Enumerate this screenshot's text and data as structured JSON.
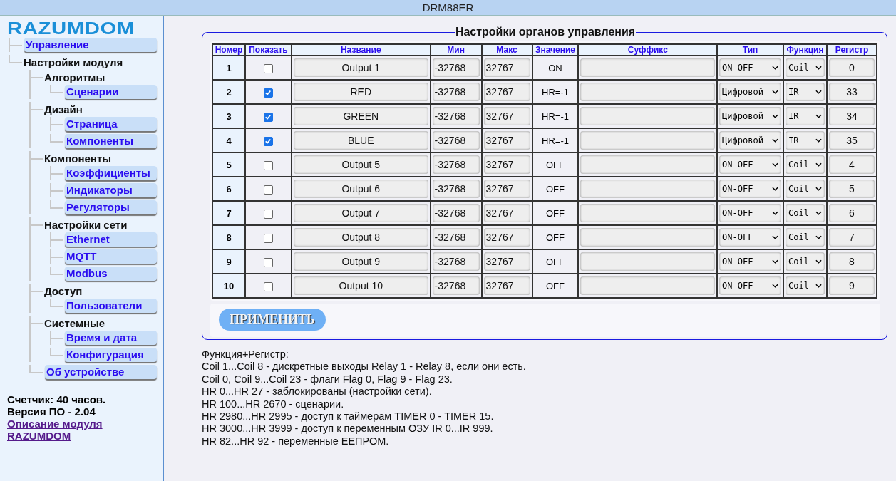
{
  "window": {
    "title": "DRM88ER"
  },
  "sidebar": {
    "logo": "RAZUMDOM",
    "items": [
      {
        "label": "Управление",
        "kind": "link"
      },
      {
        "label": "Настройки модуля",
        "kind": "group",
        "children": [
          {
            "label": "Алгоритмы",
            "kind": "group",
            "children": [
              {
                "label": "Сценарии",
                "kind": "link"
              }
            ]
          },
          {
            "label": "Дизайн",
            "kind": "group",
            "children": [
              {
                "label": "Страница",
                "kind": "link"
              },
              {
                "label": "Компоненты",
                "kind": "link"
              }
            ]
          },
          {
            "label": "Компоненты",
            "kind": "group",
            "children": [
              {
                "label": "Коэффициенты",
                "kind": "link"
              },
              {
                "label": "Индикаторы",
                "kind": "link"
              },
              {
                "label": "Регуляторы",
                "kind": "link"
              }
            ]
          },
          {
            "label": "Настройки сети",
            "kind": "group",
            "children": [
              {
                "label": "Ethernet",
                "kind": "link"
              },
              {
                "label": "MQTT",
                "kind": "link"
              },
              {
                "label": "Modbus",
                "kind": "link"
              }
            ]
          },
          {
            "label": "Доступ",
            "kind": "group",
            "children": [
              {
                "label": "Пользователи",
                "kind": "link"
              }
            ]
          },
          {
            "label": "Системные",
            "kind": "group",
            "children": [
              {
                "label": "Время и дата",
                "kind": "link"
              },
              {
                "label": "Конфигурация",
                "kind": "link"
              }
            ]
          },
          {
            "label": "Об устройстве",
            "kind": "link"
          }
        ]
      }
    ],
    "counter": "Счетчик: 40 часов.",
    "version": "Версия ПО - 2.04",
    "links": [
      "Описание модуля",
      "RAZUMDOM"
    ]
  },
  "panel": {
    "title": "Настройки органов управления",
    "table": {
      "columns": [
        "Номер",
        "Показать",
        "Название",
        "Мин",
        "Макс",
        "Значение",
        "Суффикс",
        "Тип",
        "Функция",
        "Регистр"
      ],
      "rows": [
        {
          "number": "1",
          "show": false,
          "name": "Output 1",
          "min": "-32768",
          "max": "32767",
          "value": "ON",
          "type": "ON-OFF",
          "function": "Coil",
          "register": "0"
        },
        {
          "number": "2",
          "show": true,
          "name": "RED",
          "min": "-32768",
          "max": "32767",
          "value": "HR=-1",
          "type": "Цифровой",
          "function": "IR",
          "register": "33"
        },
        {
          "number": "3",
          "show": true,
          "name": "GREEN",
          "min": "-32768",
          "max": "32767",
          "value": "HR=-1",
          "type": "Цифровой",
          "function": "IR",
          "register": "34"
        },
        {
          "number": "4",
          "show": true,
          "name": "BLUE",
          "min": "-32768",
          "max": "32767",
          "value": "HR=-1",
          "type": "Цифровой",
          "function": "IR",
          "register": "35"
        },
        {
          "number": "5",
          "show": false,
          "name": "Output 5",
          "min": "-32768",
          "max": "32767",
          "value": "OFF",
          "type": "ON-OFF",
          "function": "Coil",
          "register": "4"
        },
        {
          "number": "6",
          "show": false,
          "name": "Output 6",
          "min": "-32768",
          "max": "32767",
          "value": "OFF",
          "type": "ON-OFF",
          "function": "Coil",
          "register": "5"
        },
        {
          "number": "7",
          "show": false,
          "name": "Output 7",
          "min": "-32768",
          "max": "32767",
          "value": "OFF",
          "type": "ON-OFF",
          "function": "Coil",
          "register": "6"
        },
        {
          "number": "8",
          "show": false,
          "name": "Output 8",
          "min": "-32768",
          "max": "32767",
          "value": "OFF",
          "type": "ON-OFF",
          "function": "Coil",
          "register": "7"
        },
        {
          "number": "9",
          "show": false,
          "name": "Output 9",
          "min": "-32768",
          "max": "32767",
          "value": "OFF",
          "type": "ON-OFF",
          "function": "Coil",
          "register": "8"
        },
        {
          "number": "10",
          "show": false,
          "name": "Output 10",
          "min": "-32768",
          "max": "32767",
          "value": "OFF",
          "type": "ON-OFF",
          "function": "Coil",
          "register": "9"
        }
      ]
    },
    "apply_button": "ПРИМЕНИТЬ"
  },
  "notes": [
    "Функция+Регистр:",
    "Coil 1...Coil 8 - дискретные выходы Relay 1 - Relay 8, если они есть.",
    "Coil 0, Coil 9...Coil 23 - флаги Flag 0, Flag 9 - Flag 23.",
    "HR 0...HR 27 - заблокированы (настройки сети).",
    "HR 100...HR 2670 - сценарии.",
    "HR 2980...HR 2995 - доступ к таймерам TIMER 0 - TIMER 15.",
    "HR 3000...HR 3999 - доступ к переменным ОЗУ IR 0...IR 999.",
    "HR 82...HR 92 - переменные ЕЕПРОМ."
  ]
}
